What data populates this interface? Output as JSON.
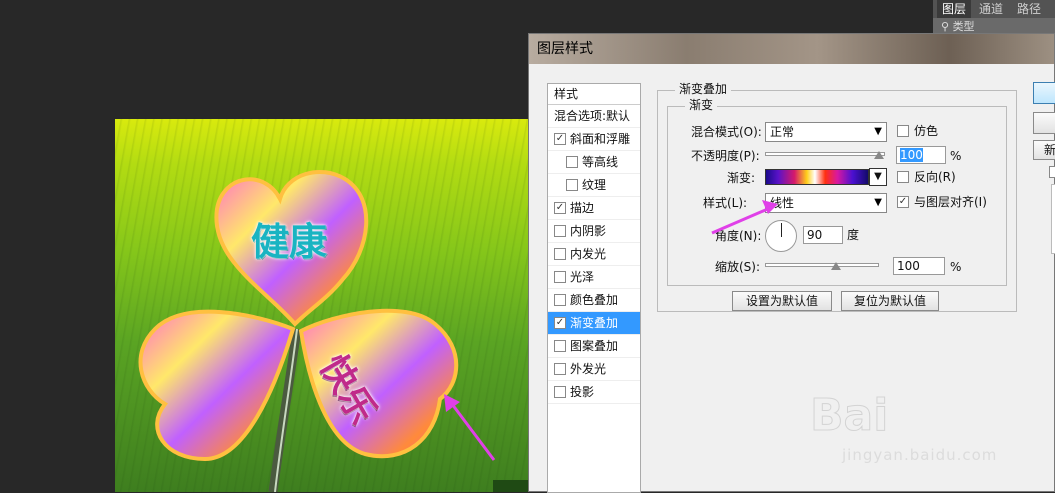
{
  "layers_panel": {
    "tabs": [
      "图层",
      "通道",
      "路径"
    ],
    "filter_label": "类型"
  },
  "canvas": {
    "text_top": "健康",
    "text_right": "快乐"
  },
  "dialog": {
    "title": "图层样式",
    "styles_panel": {
      "header": "样式",
      "blend_options": "混合选项:默认",
      "items": [
        {
          "label": "斜面和浮雕",
          "checked": "✓"
        },
        {
          "label": "等高线",
          "checked": ""
        },
        {
          "label": "纹理",
          "checked": ""
        },
        {
          "label": "描边",
          "checked": "✓"
        },
        {
          "label": "内阴影",
          "checked": ""
        },
        {
          "label": "内发光",
          "checked": ""
        },
        {
          "label": "光泽",
          "checked": ""
        },
        {
          "label": "颜色叠加",
          "checked": ""
        },
        {
          "label": "渐变叠加",
          "checked": "✓"
        },
        {
          "label": "图案叠加",
          "checked": ""
        },
        {
          "label": "外发光",
          "checked": ""
        },
        {
          "label": "投影",
          "checked": ""
        }
      ]
    },
    "section_title": "渐变叠加",
    "subsection_title": "渐变",
    "blend_mode": {
      "label": "混合模式(O):",
      "value": "正常"
    },
    "dither": {
      "label": "仿色",
      "checked": ""
    },
    "opacity": {
      "label": "不透明度(P):",
      "value": "100",
      "unit": "%",
      "level": 1.0
    },
    "gradient": {
      "label": "渐变:"
    },
    "reverse": {
      "label": "反向(R)",
      "checked": ""
    },
    "style": {
      "label": "样式(L):",
      "value": "线性"
    },
    "align": {
      "label": "与图层对齐(I)",
      "checked": "✓"
    },
    "angle": {
      "label": "角度(N):",
      "value": "90",
      "unit": "度"
    },
    "scale": {
      "label": "缩放(S):",
      "value": "100",
      "unit": "%",
      "level": 0.5
    },
    "make_default": "设置为默认值",
    "reset_default": "复位为默认值",
    "right_button_partial": "新"
  },
  "watermark": {
    "logo": "Baidu经验",
    "url": "jingyan.baidu.com"
  },
  "colors": {
    "annotation_arrow": "#e040e8",
    "selection": "#3399ff"
  }
}
